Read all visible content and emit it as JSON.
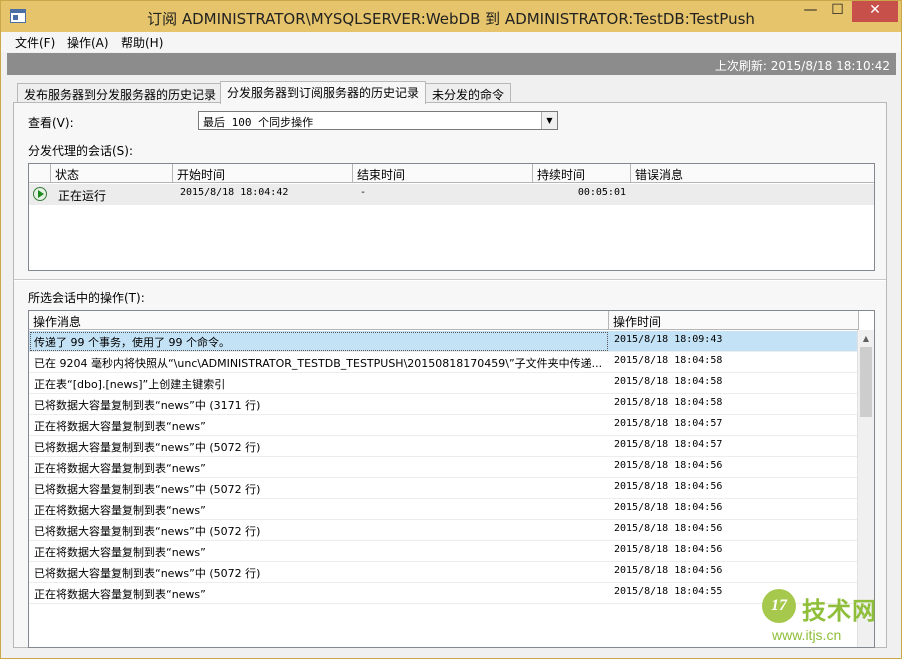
{
  "window": {
    "title": "订阅 ADMINISTRATOR\\MYSQLSERVER:WebDB 到 ADMINISTRATOR:TestDB:TestPush",
    "min_glyph": "—",
    "max_glyph": "☐",
    "close_glyph": "✕"
  },
  "menu": {
    "file": "文件(F)",
    "action": "操作(A)",
    "help": "帮助(H)"
  },
  "refresh": {
    "label": "上次刷新: 2015/8/18 18:10:42"
  },
  "tabs": [
    {
      "label": "发布服务器到分发服务器的历史记录",
      "active": false
    },
    {
      "label": "分发服务器到订阅服务器的历史记录",
      "active": true
    },
    {
      "label": "未分发的命令",
      "active": false
    }
  ],
  "view": {
    "label": "查看(V):",
    "selected": "最后 100 个同步操作"
  },
  "sessions": {
    "label": "分发代理的会话(S):",
    "columns": [
      "状态",
      "开始时间",
      "结束时间",
      "持续时间",
      "错误消息"
    ],
    "rows": [
      {
        "status": "正在运行",
        "start": "2015/8/18 18:04:42",
        "end": "-",
        "duration": "00:05:01",
        "error": ""
      }
    ]
  },
  "operations": {
    "label": "所选会话中的操作(T):",
    "columns": [
      "操作消息",
      "操作时间"
    ],
    "rows": [
      {
        "message": "传递了 99 个事务，使用了 99 个命令。",
        "time": "2015/8/18 18:09:43"
      },
      {
        "message": "已在 9204 毫秒内将快照从“\\unc\\ADMINISTRATOR_TESTDB_TESTPUSH\\20150818170459\\”子文件夹中传递...",
        "time": "2015/8/18 18:04:58"
      },
      {
        "message": "正在表“[dbo].[news]”上创建主键索引",
        "time": "2015/8/18 18:04:58"
      },
      {
        "message": "已将数据大容量复制到表“news”中 (3171 行)",
        "time": "2015/8/18 18:04:58"
      },
      {
        "message": "正在将数据大容量复制到表“news”",
        "time": "2015/8/18 18:04:57"
      },
      {
        "message": "已将数据大容量复制到表“news”中 (5072 行)",
        "time": "2015/8/18 18:04:57"
      },
      {
        "message": "正在将数据大容量复制到表“news”",
        "time": "2015/8/18 18:04:56"
      },
      {
        "message": "已将数据大容量复制到表“news”中 (5072 行)",
        "time": "2015/8/18 18:04:56"
      },
      {
        "message": "正在将数据大容量复制到表“news”",
        "time": "2015/8/18 18:04:56"
      },
      {
        "message": "已将数据大容量复制到表“news”中 (5072 行)",
        "time": "2015/8/18 18:04:56"
      },
      {
        "message": "正在将数据大容量复制到表“news”",
        "time": "2015/8/18 18:04:56"
      },
      {
        "message": "已将数据大容量复制到表“news”中 (5072 行)",
        "time": "2015/8/18 18:04:56"
      },
      {
        "message": "正在将数据大容量复制到表“news”",
        "time": "2015/8/18 18:04:55"
      }
    ]
  },
  "watermark": {
    "badge": "17",
    "text": "技术网",
    "url": "www.itjs.cn"
  }
}
